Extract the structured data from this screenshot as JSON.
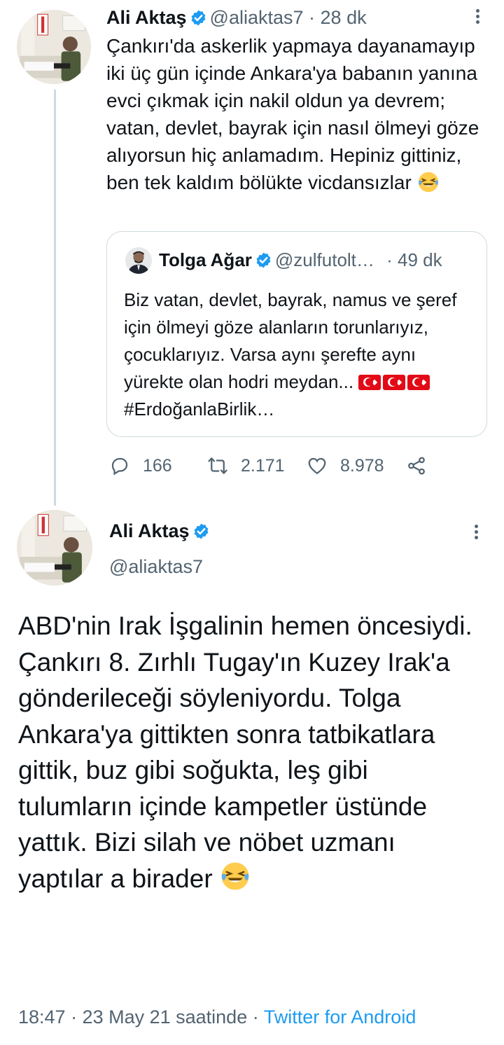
{
  "thread": {
    "first_tweet": {
      "author_name": "Ali Aktaş",
      "handle": "@aliaktas7",
      "time": "· 28 dk",
      "text": "Çankırı'da askerlik yapmaya dayanamayıp iki üç gün içinde Ankara'ya babanın yanına evci çıkmak için nakil oldun ya devrem; vatan, devlet, bayrak için nasıl ölmeyi göze alıyorsun hiç anlamadım. Hepiniz gittiniz, ben tek kaldım bölükte vicdansızlar",
      "quoted": {
        "author_name": "Tolga Ağar",
        "handle": "@zulfutoltoltol",
        "time": "· 49 dk",
        "text": "Biz vatan, devlet, bayrak, namus ve şeref için ölmeyi göze alanların torunlarıyız, çocuklarıyız. Varsa aynı şerefte aynı yürekte olan hodri meydan...",
        "hashtag": "#ErdoğanlaBirlik…"
      },
      "actions": {
        "replies": "166",
        "retweets": "2.171",
        "likes": "8.978"
      }
    },
    "second_tweet": {
      "author_name": "Ali Aktaş",
      "handle": "@aliaktas7",
      "text": "ABD'nin Irak İşgalinin hemen öncesiydi. Çankırı 8. Zırhlı Tugay'ın Kuzey Irak'a gönderileceği söyleniyordu. Tolga Ankara'ya gittikten sonra tatbikatlara gittik, buz gibi soğukta, leş gibi tulumların içinde kampetler üstünde yattık. Bizi silah ve nöbet uzmanı yaptılar a birader",
      "timestamp": "18:47 · 23 May 21 saatinde · ",
      "source": "Twitter for Android"
    }
  },
  "colors": {
    "text_primary": "#0f1419",
    "text_secondary": "#536471",
    "accent": "#1d9bf0",
    "border": "#cfd9de"
  }
}
